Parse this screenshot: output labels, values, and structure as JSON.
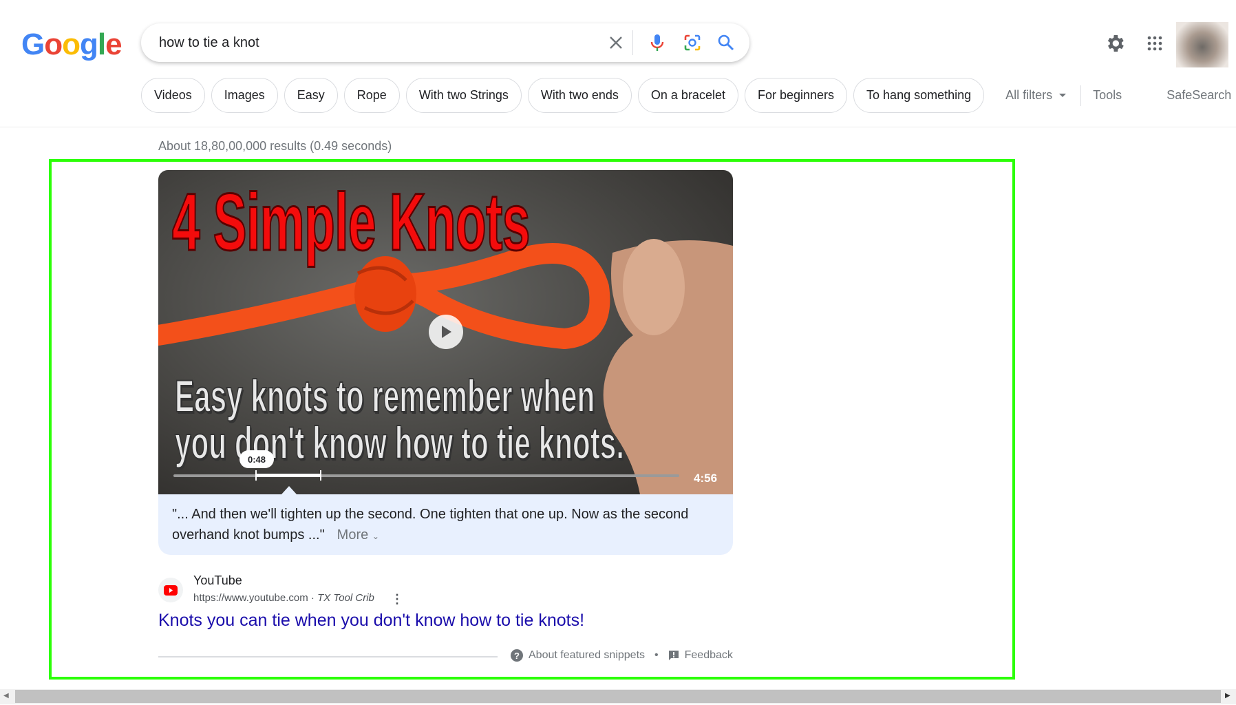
{
  "header": {
    "logo": "Google",
    "search_value": "how to tie a knot",
    "icons": [
      "clear-icon",
      "microphone-icon",
      "lens-icon",
      "search-icon",
      "settings-icon",
      "apps-icon",
      "avatar"
    ]
  },
  "chips": [
    "Videos",
    "Images",
    "Easy",
    "Rope",
    "With two Strings",
    "With two ends",
    "On a bracelet",
    "For beginners",
    "To hang something"
  ],
  "tools": {
    "all_filters": "All filters",
    "tools": "Tools",
    "safesearch": "SafeSearch"
  },
  "stats": "About 18,80,00,000 results (0.49 seconds)",
  "snippet": {
    "thumbnail_title": "4 Simple Knots",
    "thumbnail_line1": "Easy knots to remember when",
    "thumbnail_line2": "you don't know how to tie knots.",
    "timestamp": "0:48",
    "duration": "4:56",
    "quote": "\"... And then we'll tighten up the second. One tighten that one up. Now as the second overhand knot bumps ...\"",
    "more": "More",
    "site": "YouTube",
    "url": "https://www.youtube.com",
    "channel": "TX Tool Crib",
    "title": "Knots you can tie when you don't know how to tie knots!",
    "about": "About featured snippets",
    "feedback": "Feedback"
  },
  "colors": {
    "highlight_box": "#2cff07",
    "link": "#1a0dab",
    "snippet_bg": "#e8f0fe"
  }
}
